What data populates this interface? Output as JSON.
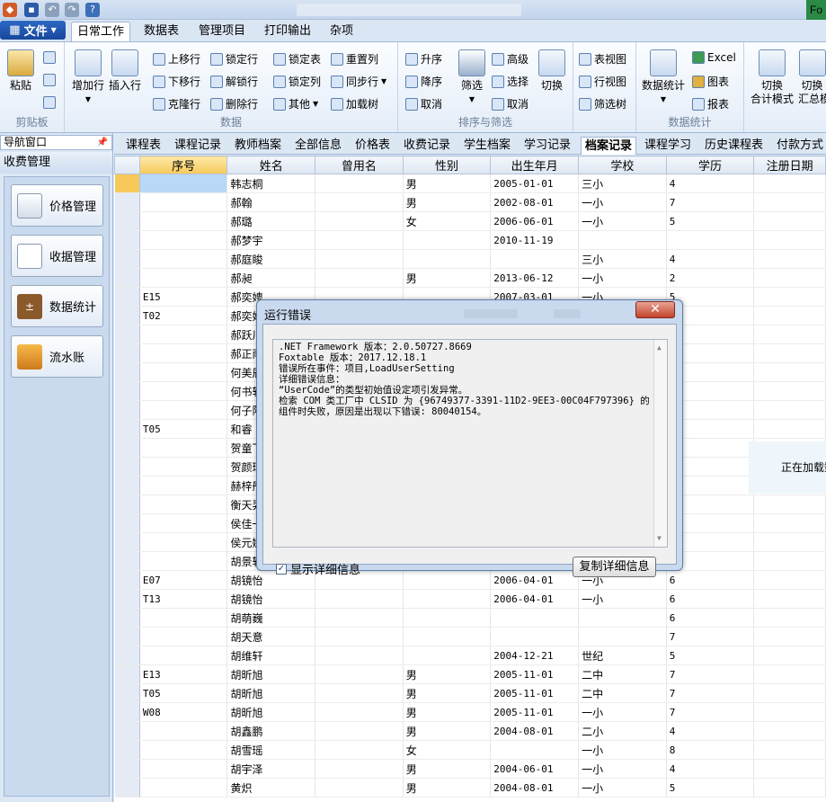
{
  "window": {
    "title_right": "Fo"
  },
  "ribbon_tabs": {
    "file": "文件",
    "daily": "日常工作",
    "data_table": "数据表",
    "manage": "管理项目",
    "print": "打印输出",
    "misc": "杂项"
  },
  "ribbon": {
    "clipboard": {
      "paste": "粘贴",
      "label": "剪贴板"
    },
    "data": {
      "add_row": "增加行",
      "insert_row": "插入行",
      "move_up": "上移行",
      "move_down": "下移行",
      "clone_row": "克隆行",
      "lock_row": "锁定行",
      "unlock_row": "解锁行",
      "delete_row": "删除行",
      "lock_table": "锁定表",
      "lock_col": "锁定列",
      "other": "其他",
      "reset_col": "重置列",
      "sync_row": "同步行",
      "load_tree": "加载树",
      "label": "数据"
    },
    "sort": {
      "asc": "升序",
      "desc": "降序",
      "cancel": "取消",
      "filter": "筛选",
      "advanced": "高级",
      "select": "选择",
      "cancel2": "取消",
      "switch": "切换",
      "label": "排序与筛选"
    },
    "view": {
      "table_view": "表视图",
      "row_view": "行视图",
      "filter_tree": "筛选树"
    },
    "stats": {
      "data_stats": "数据统计",
      "excel": "Excel",
      "chart": "图表",
      "report": "报表",
      "label": "数据统计"
    },
    "mode": {
      "line1": "切换",
      "line2": "合计模式",
      "line3": "切换",
      "line4": "汇总模"
    }
  },
  "nav": {
    "header": "导航窗口",
    "pin": "📌",
    "section": "收费管理",
    "buttons": [
      "价格管理",
      "收据管理",
      "数据统计",
      "流水账"
    ]
  },
  "sheet_tabs": [
    "课程表",
    "课程记录",
    "教师档案",
    "全部信息",
    "价格表",
    "收费记录",
    "学生档案",
    "学习记录",
    "档案记录",
    "课程学习",
    "历史课程表",
    "付款方式"
  ],
  "grid": {
    "columns": [
      "序号",
      "姓名",
      "曾用名",
      "性别",
      "出生年月",
      "学校",
      "学历",
      "注册日期"
    ],
    "rows": [
      [
        "",
        "韩志桐",
        "",
        "男",
        "2005-01-01",
        "三小",
        "4",
        ""
      ],
      [
        "",
        "郝翰",
        "",
        "男",
        "2002-08-01",
        "一小",
        "7",
        ""
      ],
      [
        "",
        "郝璐",
        "",
        "女",
        "2006-06-01",
        "一小",
        "5",
        ""
      ],
      [
        "",
        "郝梦宇",
        "",
        "",
        "2010-11-19",
        "",
        "",
        ""
      ],
      [
        "",
        "郝庭睃",
        "",
        "",
        "",
        "三小",
        "4",
        ""
      ],
      [
        "",
        "郝昶",
        "",
        "男",
        "2013-06-12",
        "一小",
        "2",
        ""
      ],
      [
        "E15",
        "郝奕娉",
        "",
        "",
        "2007-03-01",
        "一小",
        "5",
        ""
      ],
      [
        "T02",
        "郝奕娉",
        "",
        "",
        "",
        "",
        "",
        ""
      ],
      [
        "",
        "郝跃川",
        "",
        "",
        "",
        "",
        "",
        ""
      ],
      [
        "",
        "郝正雨",
        "",
        "",
        "",
        "",
        "",
        ""
      ],
      [
        "",
        "何美辰",
        "",
        "",
        "",
        "",
        "",
        ""
      ],
      [
        "",
        "何书轩",
        "",
        "",
        "",
        "",
        "",
        ""
      ],
      [
        "",
        "何子阳",
        "",
        "",
        "",
        "",
        "",
        ""
      ],
      [
        "T05",
        "和睿",
        "",
        "",
        "",
        "",
        "",
        ""
      ],
      [
        "",
        "贺童飞",
        "",
        "",
        "",
        "",
        "",
        ""
      ],
      [
        "",
        "贺颜琪",
        "",
        "",
        "",
        "",
        "",
        ""
      ],
      [
        "",
        "赫梓彤",
        "",
        "",
        "",
        "",
        "",
        ""
      ],
      [
        "",
        "衡天羿",
        "",
        "",
        "",
        "",
        "",
        ""
      ],
      [
        "",
        "侯佳一",
        "",
        "",
        "",
        "",
        "",
        ""
      ],
      [
        "",
        "侯元娜",
        "",
        "",
        "",
        "",
        "",
        ""
      ],
      [
        "",
        "胡景轩",
        "",
        "",
        "",
        "",
        "",
        ""
      ],
      [
        "E07",
        "胡镜怡",
        "",
        "",
        "2006-04-01",
        "一小",
        "6",
        ""
      ],
      [
        "T13",
        "胡镜怡",
        "",
        "",
        "2006-04-01",
        "一小",
        "6",
        ""
      ],
      [
        "",
        "胡萌巍",
        "",
        "",
        "",
        "",
        "6",
        ""
      ],
      [
        "",
        "胡天意",
        "",
        "",
        "",
        "",
        "7",
        ""
      ],
      [
        "",
        "胡维轩",
        "",
        "",
        "2004-12-21",
        "世纪",
        "5",
        ""
      ],
      [
        "E13",
        "胡昕旭",
        "",
        "男",
        "2005-11-01",
        "二中",
        "7",
        ""
      ],
      [
        "T05",
        "胡昕旭",
        "",
        "男",
        "2005-11-01",
        "二中",
        "7",
        ""
      ],
      [
        "W08",
        "胡昕旭",
        "",
        "男",
        "2005-11-01",
        "一小",
        "7",
        ""
      ],
      [
        "",
        "胡鑫鹏",
        "",
        "男",
        "2004-08-01",
        "二小",
        "4",
        ""
      ],
      [
        "",
        "胡雪瑶",
        "",
        "女",
        "",
        "一小",
        "8",
        ""
      ],
      [
        "",
        "胡宇泽",
        "",
        "男",
        "2004-06-01",
        "一小",
        "4",
        ""
      ],
      [
        "",
        "黄炽",
        "",
        "男",
        "2004-08-01",
        "一小",
        "5",
        ""
      ]
    ]
  },
  "loading_text": "正在加载数",
  "dialog": {
    "title": "运行错误",
    "close": "✕",
    "lines": [
      ".NET Framework 版本：2.0.50727.8669",
      "Foxtable 版本：2017.12.18.1",
      "错误所在事件：项目,LoadUserSetting",
      "详细错误信息：",
      "“UserCode”的类型初始值设定项引发异常。",
      "检索 COM 类工厂中 CLSID 为 {96749377-3391-11D2-9EE3-00C04F797396} 的组件时失败，原因是出现以下错误: 80040154。"
    ],
    "show_details": "显示详细信息",
    "copy_details": "复制详细信息"
  },
  "colors": {
    "accent": "#f7c95a",
    "file_button": "#1f56ad",
    "close_button": "#c3432c"
  }
}
